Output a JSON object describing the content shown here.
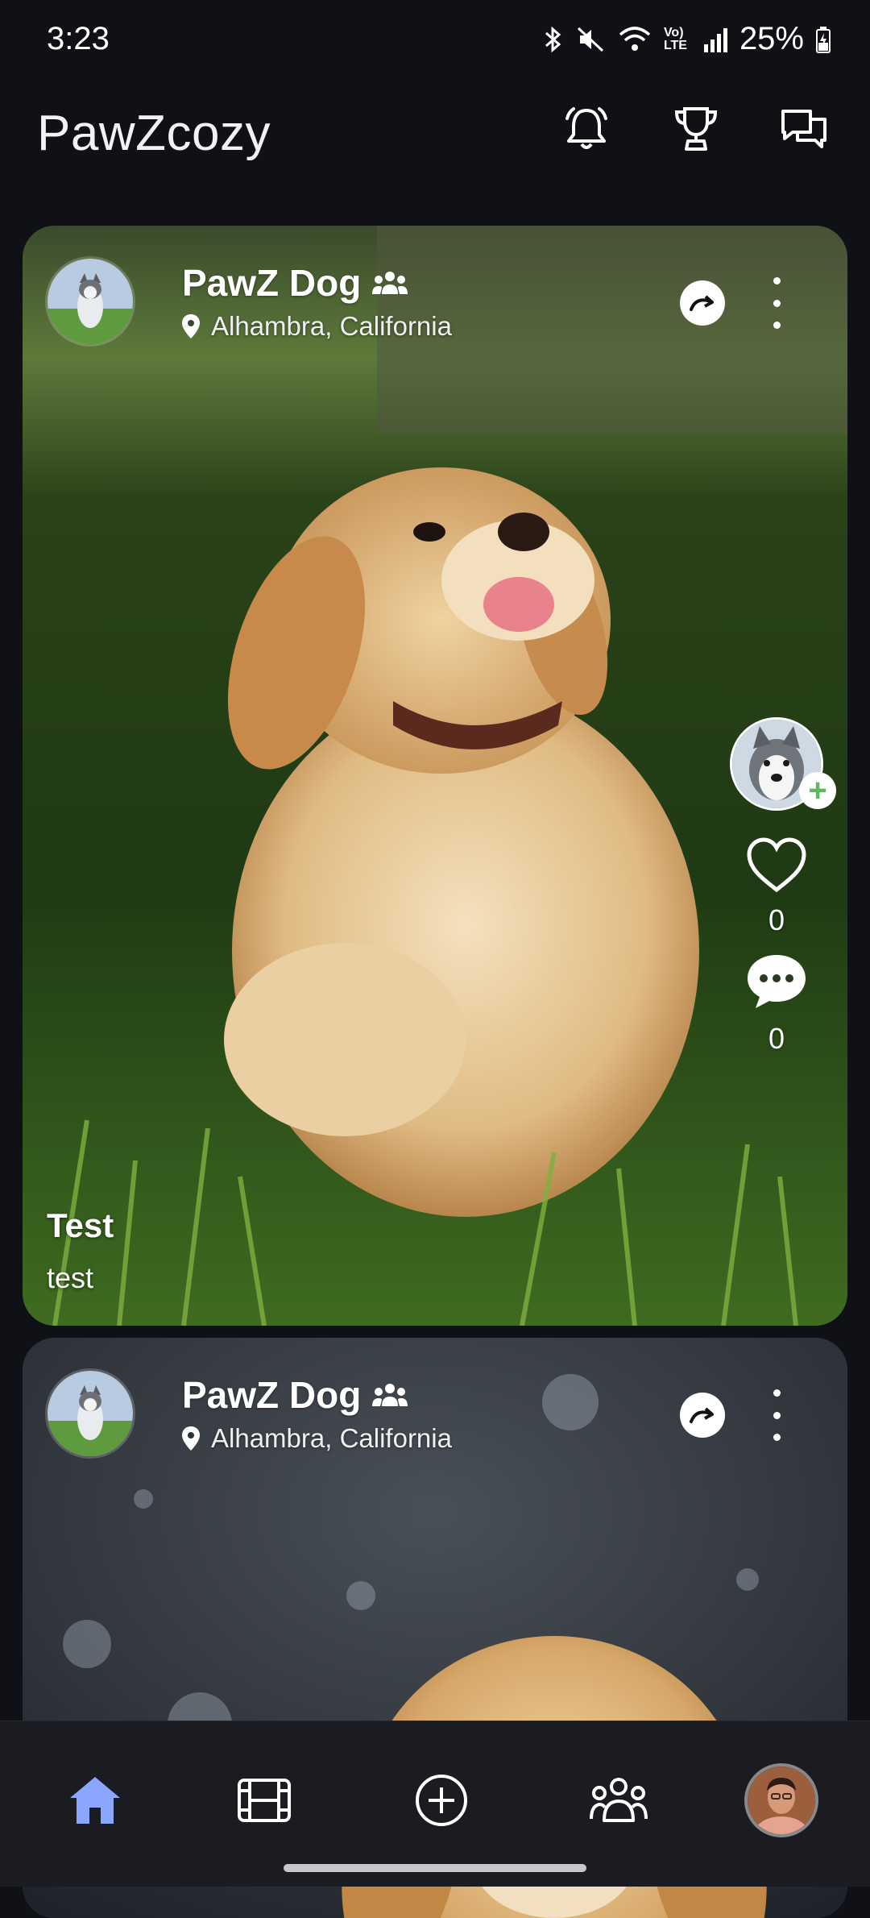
{
  "status_bar": {
    "time": "3:23",
    "battery": "25%",
    "network": "Vo) LTE"
  },
  "app": {
    "title": "PawZcozy",
    "icons": [
      "bell-icon",
      "trophy-icon",
      "chat-icon"
    ]
  },
  "posts": [
    {
      "name": "PawZ Dog",
      "location": "Alhambra, California",
      "likes": "0",
      "comments": "0",
      "caption_title": "Test",
      "caption_text": "test"
    },
    {
      "name": "PawZ Dog",
      "location": "Alhambra, California"
    }
  ],
  "bottom_nav": {
    "items": [
      "home-icon",
      "reels-icon",
      "add-icon",
      "community-icon",
      "profile-avatar"
    ],
    "active": "home-icon",
    "active_color": "#8aa6ff"
  }
}
